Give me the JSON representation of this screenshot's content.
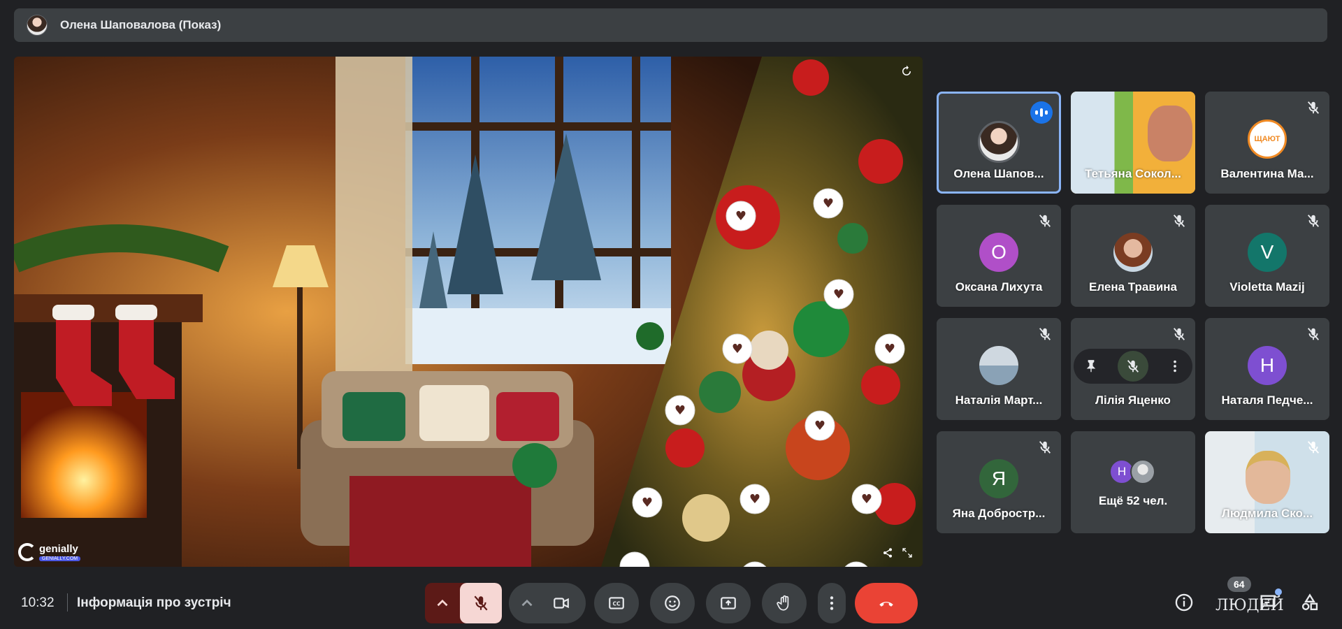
{
  "presenter_bar": {
    "name": "Олена Шаповалова (Показ)"
  },
  "presentation": {
    "brand": "genially",
    "brand_sub": "GENIALLY.COM"
  },
  "tiles": [
    {
      "name": "Олена Шапов...",
      "state": "speaking"
    },
    {
      "name": "Тетьяна Сокол...",
      "state": "video"
    },
    {
      "name": "Валентина Ма...",
      "state": "muted",
      "avatar_text": "ЩАЮТ"
    },
    {
      "name": "Оксана Лихута",
      "state": "muted",
      "avatar_letter": "О",
      "avatar_color": "#b04fc8"
    },
    {
      "name": "Елена Травина",
      "state": "muted"
    },
    {
      "name": "Violetta Mazij",
      "state": "muted",
      "avatar_letter": "V",
      "avatar_color": "#13766a"
    },
    {
      "name": "Наталія Март...",
      "state": "muted"
    },
    {
      "name": "Лілія Яценко",
      "state": "hover"
    },
    {
      "name": "Наталя Педче...",
      "state": "muted",
      "avatar_letter": "Н",
      "avatar_color": "#7e4fd1"
    },
    {
      "name": "Яна Добростр...",
      "state": "muted",
      "avatar_letter": "Я",
      "avatar_color": "#32663b"
    },
    {
      "name": "Ещё 52 чел.",
      "state": "more",
      "avatar_letter": "Н",
      "avatar_color": "#7e4fd1"
    },
    {
      "name": "Людмила Ско...",
      "state": "video-muted"
    }
  ],
  "bottom_bar": {
    "time": "10:32",
    "meeting_info": "Інформація про зустріч",
    "people_count": "64",
    "people_label": "ЛЮДЕЙ"
  },
  "colors": {
    "background": "#202124",
    "tile": "#3c4043",
    "active_outline": "#8ab4f8",
    "end_call": "#ea4335",
    "speaking": "#1a73e8"
  }
}
